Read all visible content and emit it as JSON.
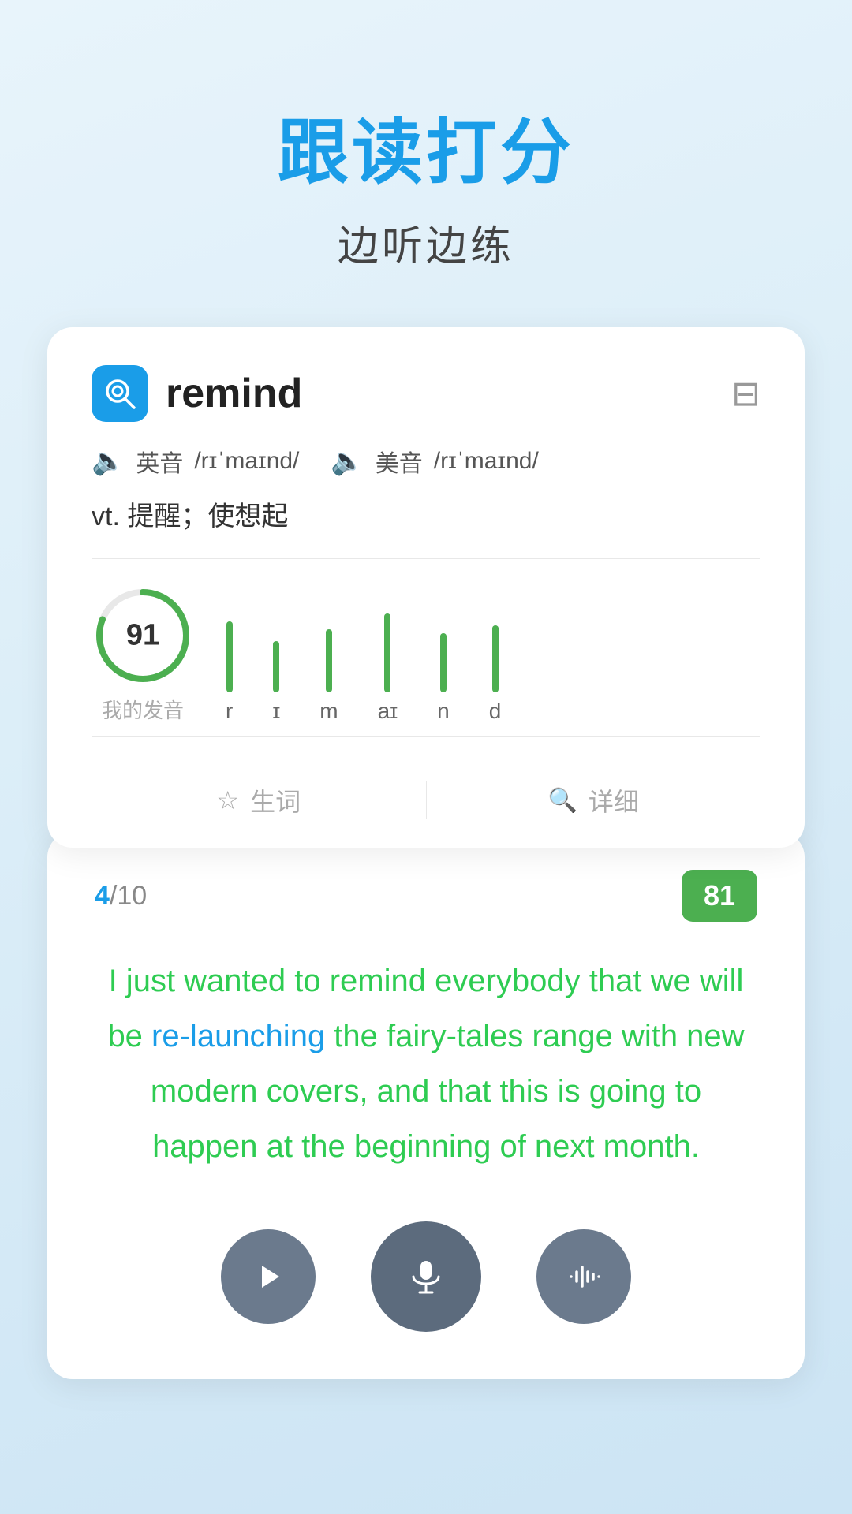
{
  "header": {
    "title": "跟读打分",
    "subtitle": "边听边练"
  },
  "word_card": {
    "word": "remind",
    "phonetic_en_label": "英音",
    "phonetic_en": "/rɪˈmaɪnd/",
    "phonetic_us_label": "美音",
    "phonetic_us": "/rɪˈmaɪnd/",
    "definition": "vt. 提醒；使想起",
    "score": "91",
    "score_label": "我的发音",
    "phonemes": [
      "r",
      "ɪ",
      "m",
      "aɪ",
      "n",
      "d"
    ],
    "footer_vocab": "生词",
    "footer_detail": "详细"
  },
  "reading_card": {
    "progress_current": "4",
    "progress_total": "10",
    "score_badge": "81",
    "text": "I just wanted to remind everybody that we will be re-launching the fairy-tales range with new modern covers, and that this is going to happen at the beginning of next month."
  },
  "controls": {
    "play_label": "play",
    "mic_label": "microphone",
    "waveform_label": "waveform"
  }
}
